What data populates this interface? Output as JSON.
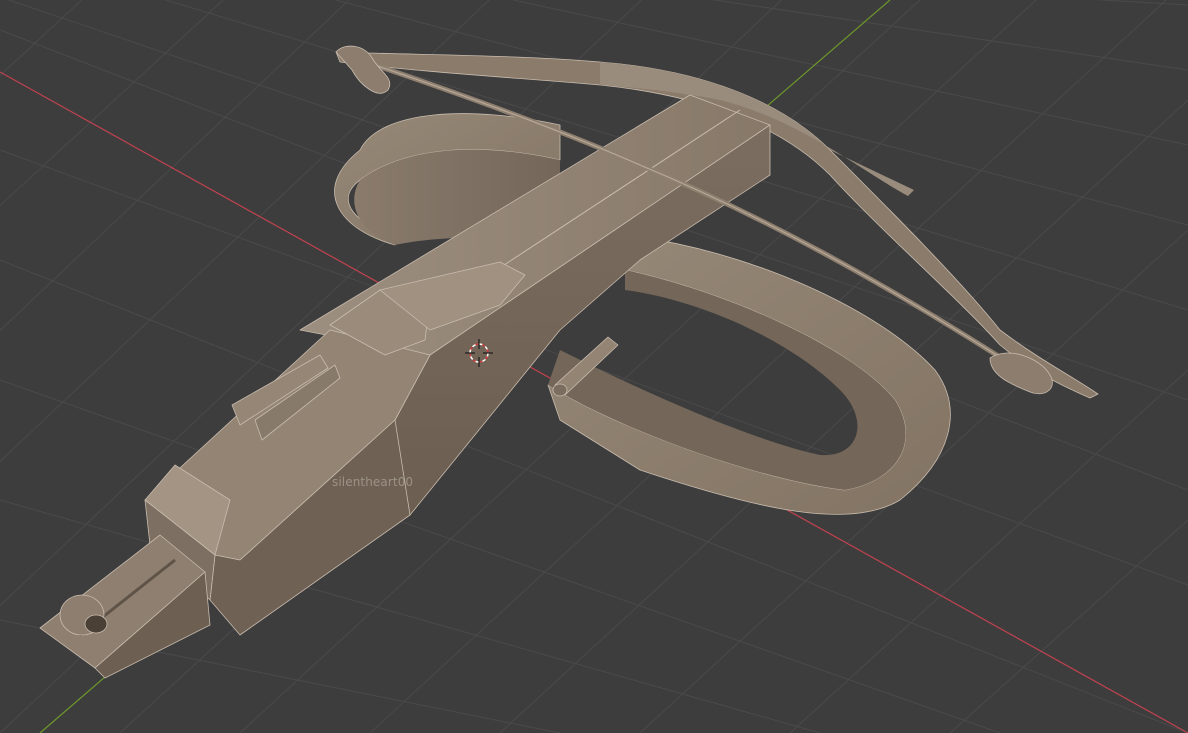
{
  "app": {
    "name": "",
    "view": "3D Viewport"
  },
  "viewport": {
    "background_color": "#3d3d3d",
    "grid_color": "#4a4a4a",
    "x_axis_color": "#c2424f",
    "y_axis_color": "#6e9a2a",
    "model_color": "#8b7c6d",
    "edge_highlight_color": "#c9bcae",
    "watermark_text": "silentheart00",
    "icons": {
      "cursor": "3d-cursor-icon"
    }
  }
}
